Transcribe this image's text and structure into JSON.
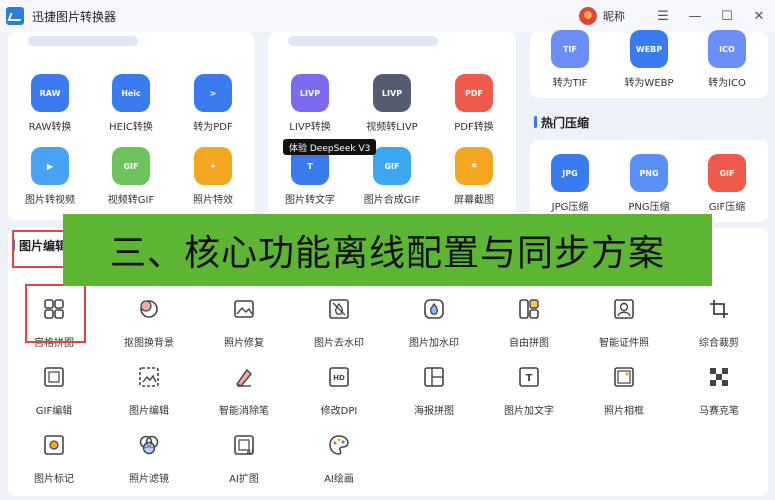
{
  "app": {
    "title": "迅捷图片转换器",
    "nickname": "昵称"
  },
  "window_controls": {
    "menu": "☰",
    "minimize": "—",
    "maximize": "☐",
    "close": "✕"
  },
  "convert_tools_left": [
    {
      "label": "RAW转换",
      "tag": "RAW",
      "color": "#3a7bf0"
    },
    {
      "label": "HEIC转换",
      "tag": "Heic",
      "color": "#3a7bf0"
    },
    {
      "label": "转为PDF",
      "tag": ">",
      "color": "#3a7bf0"
    },
    {
      "label": "图片转视频",
      "tag": "▶",
      "color": "#49a3f5"
    },
    {
      "label": "视频转GIF",
      "tag": "GIF",
      "color": "#6cc35a"
    },
    {
      "label": "照片特效",
      "tag": "✦",
      "color": "#f5a623"
    }
  ],
  "convert_tools_mid": [
    {
      "label": "LIVP转换",
      "tag": "LIVP",
      "color": "#7b6bf0"
    },
    {
      "label": "视频转LIVP",
      "tag": "LIVP",
      "color": "#555c70"
    },
    {
      "label": "PDF转换",
      "tag": "PDF",
      "color": "#ef5a4a"
    },
    {
      "label": "图片转文字",
      "tag": "T",
      "color": "#3a7bf0"
    },
    {
      "label": "图片合成GIF",
      "tag": "GIF",
      "color": "#3aa7f0"
    },
    {
      "label": "屏幕截图",
      "tag": "⌗",
      "color": "#f5a623"
    }
  ],
  "convert_tools_right": [
    {
      "label": "转为TIF",
      "tag": "TIF",
      "color": "#6b8ff5"
    },
    {
      "label": "转为WEBP",
      "tag": "WEBP",
      "color": "#3a7bf0"
    },
    {
      "label": "转为ICO",
      "tag": "ICO",
      "color": "#6b8ff5"
    }
  ],
  "compress": {
    "title": "热门压缩",
    "tools": [
      {
        "label": "JPG压缩",
        "tag": "JPG",
        "color": "#3a7bf0"
      },
      {
        "label": "PNG压缩",
        "tag": "PNG",
        "color": "#5a8ff5"
      },
      {
        "label": "GIF压缩",
        "tag": "GIF",
        "color": "#ef5a4a"
      }
    ]
  },
  "deepseek_badge": "体验 DeepSeek V3",
  "edit_section": {
    "title": "图片编辑"
  },
  "banner_text": "三、核心功能离线配置与同步方案",
  "edit_tools": [
    {
      "label": "宫格拼图",
      "icon": "grid-icon"
    },
    {
      "label": "抠图换背景",
      "icon": "cutout-icon"
    },
    {
      "label": "照片修复",
      "icon": "photo-repair-icon"
    },
    {
      "label": "图片去水印",
      "icon": "remove-watermark-icon"
    },
    {
      "label": "图片加水印",
      "icon": "add-watermark-icon"
    },
    {
      "label": "自由拼图",
      "icon": "free-collage-icon"
    },
    {
      "label": "智能证件照",
      "icon": "id-photo-icon"
    },
    {
      "label": "综合裁剪",
      "icon": "crop-icon"
    },
    {
      "label": "GIF编辑",
      "icon": "gif-edit-icon"
    },
    {
      "label": "图片编辑",
      "icon": "image-edit-icon"
    },
    {
      "label": "智能消除笔",
      "icon": "eraser-pen-icon"
    },
    {
      "label": "修改DPI",
      "icon": "dpi-icon"
    },
    {
      "label": "海报拼图",
      "icon": "poster-icon"
    },
    {
      "label": "图片加文字",
      "icon": "add-text-icon"
    },
    {
      "label": "照片相框",
      "icon": "frame-icon"
    },
    {
      "label": "马赛克笔",
      "icon": "mosaic-icon"
    },
    {
      "label": "图片标记",
      "icon": "mark-icon"
    },
    {
      "label": "照片滤镜",
      "icon": "filter-icon"
    },
    {
      "label": "AI扩图",
      "icon": "ai-expand-icon"
    },
    {
      "label": "AI绘画",
      "icon": "ai-paint-icon"
    }
  ]
}
